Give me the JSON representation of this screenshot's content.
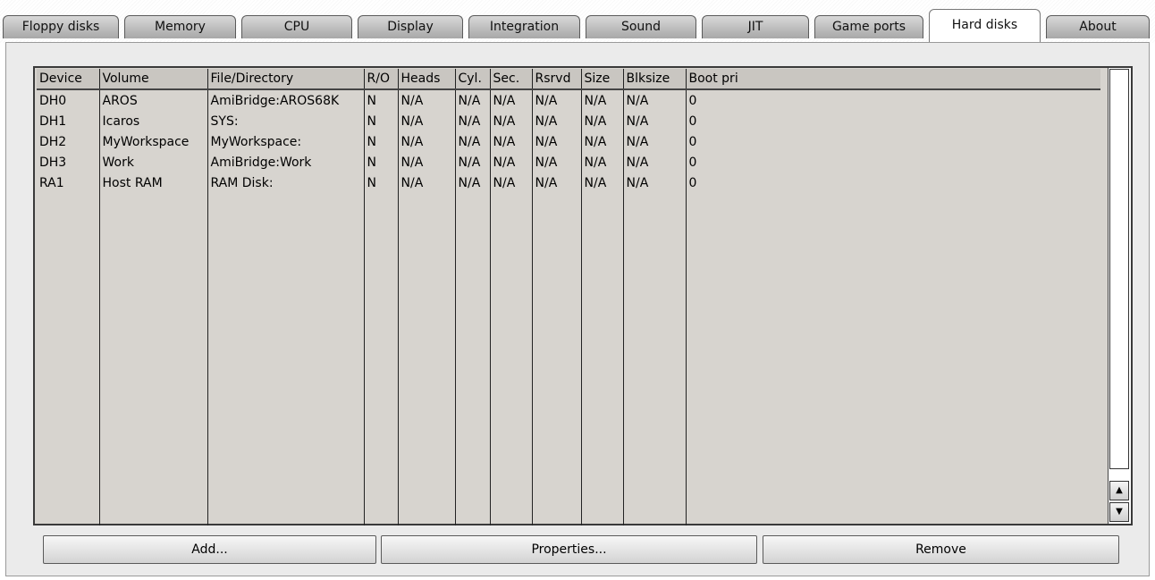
{
  "tabs": [
    {
      "label": "Floppy disks"
    },
    {
      "label": "Memory"
    },
    {
      "label": "CPU"
    },
    {
      "label": "Display"
    },
    {
      "label": "Integration"
    },
    {
      "label": "Sound"
    },
    {
      "label": "JIT"
    },
    {
      "label": "Game ports"
    },
    {
      "label": "Hard disks",
      "active": true
    },
    {
      "label": "About"
    }
  ],
  "table": {
    "columns": [
      "Device",
      "Volume",
      "File/Directory",
      "R/O",
      "Heads",
      "Cyl.",
      "Sec.",
      "Rsrvd",
      "Size",
      "Blksize",
      "Boot pri"
    ],
    "rows": [
      [
        "DH0",
        "AROS",
        "AmiBridge:AROS68K",
        "N",
        "N/A",
        "N/A",
        "N/A",
        "N/A",
        "N/A",
        "N/A",
        "0"
      ],
      [
        "DH1",
        "Icaros",
        "SYS:",
        "N",
        "N/A",
        "N/A",
        "N/A",
        "N/A",
        "N/A",
        "N/A",
        "0"
      ],
      [
        "DH2",
        "MyWorkspace",
        "MyWorkspace:",
        "N",
        "N/A",
        "N/A",
        "N/A",
        "N/A",
        "N/A",
        "N/A",
        "0"
      ],
      [
        "DH3",
        "Work",
        "AmiBridge:Work",
        "N",
        "N/A",
        "N/A",
        "N/A",
        "N/A",
        "N/A",
        "N/A",
        "0"
      ],
      [
        "RA1",
        "Host RAM",
        "RAM Disk:",
        "N",
        "N/A",
        "N/A",
        "N/A",
        "N/A",
        "N/A",
        "N/A",
        "0"
      ]
    ]
  },
  "scrollbar": {
    "up_icon": "arrow-up-icon",
    "down_icon": "arrow-down-icon"
  },
  "buttons": {
    "add": "Add...",
    "properties": "Properties...",
    "remove": "Remove"
  }
}
